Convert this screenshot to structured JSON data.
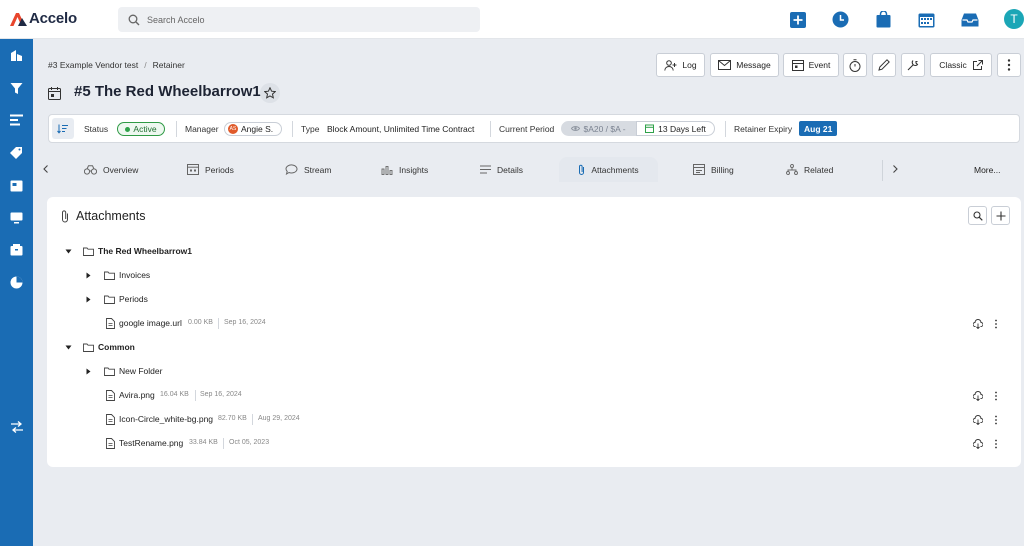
{
  "app": {
    "name": "Accelo",
    "search_placeholder": "Search Accelo",
    "user_initial": "T"
  },
  "topbar_icons": [
    "add-square-icon",
    "clock-icon",
    "bag-icon",
    "calendar-icon",
    "inbox-icon"
  ],
  "leftnav_icons": [
    "buildings-icon",
    "funnel-icon",
    "list-icon",
    "tag-icon",
    "card-icon",
    "monitor-icon",
    "box-icon",
    "pie-chart-icon",
    "transfer-icon"
  ],
  "breadcrumb": [
    "#3 Example Vendor test",
    "Retainer"
  ],
  "breadcrumb_sep": "/",
  "actions": {
    "log": "Log",
    "message": "Message",
    "event": "Event",
    "classic": "Classic"
  },
  "title": "#5 The Red Wheelbarrow1",
  "info": {
    "status_label": "Status",
    "status_value": "Active",
    "manager_label": "Manager",
    "manager_initials": "AS",
    "manager_value": "Angie S.",
    "type_label": "Type",
    "type_value": "Block Amount, Unlimited Time Contract",
    "period_label": "Current Period",
    "period_value": "$A20 / $A -",
    "days_left": "13 Days Left",
    "expiry_label": "Retainer Expiry",
    "expiry_value": "Aug 21"
  },
  "tabs": [
    {
      "label": "Overview",
      "icon": "binoculars-icon"
    },
    {
      "label": "Periods",
      "icon": "calendar-grid-icon"
    },
    {
      "label": "Stream",
      "icon": "chat-icon"
    },
    {
      "label": "Insights",
      "icon": "bar-chart-icon"
    },
    {
      "label": "Details",
      "icon": "lines-icon"
    },
    {
      "label": "Attachments",
      "icon": "paperclip-icon"
    },
    {
      "label": "Billing",
      "icon": "billing-icon"
    },
    {
      "label": "Related",
      "icon": "hierarchy-icon"
    }
  ],
  "tab_more": "More...",
  "attachments": {
    "title": "Attachments",
    "groups": [
      {
        "name": "The Red Wheelbarrow1",
        "bold": true
      },
      {
        "name": "Invoices"
      },
      {
        "name": "Periods"
      },
      {
        "name": "google image.url",
        "size": "0.00 KB",
        "date": "Sep 16, 2024"
      },
      {
        "name": "Common",
        "bold": true
      },
      {
        "name": "New Folder"
      },
      {
        "name": "Avira.png",
        "size": "16.04 KB",
        "date": "Sep 16, 2024"
      },
      {
        "name": "Icon-Circle_white-bg.png",
        "size": "82.70 KB",
        "date": "Aug 29, 2024"
      },
      {
        "name": "TestRename.png",
        "size": "33.84 KB",
        "date": "Oct 05, 2023"
      }
    ]
  },
  "colors": {
    "brand_blue": "#1a6cb4",
    "active_green": "#2fa24a",
    "logo_red": "#e8452c"
  }
}
